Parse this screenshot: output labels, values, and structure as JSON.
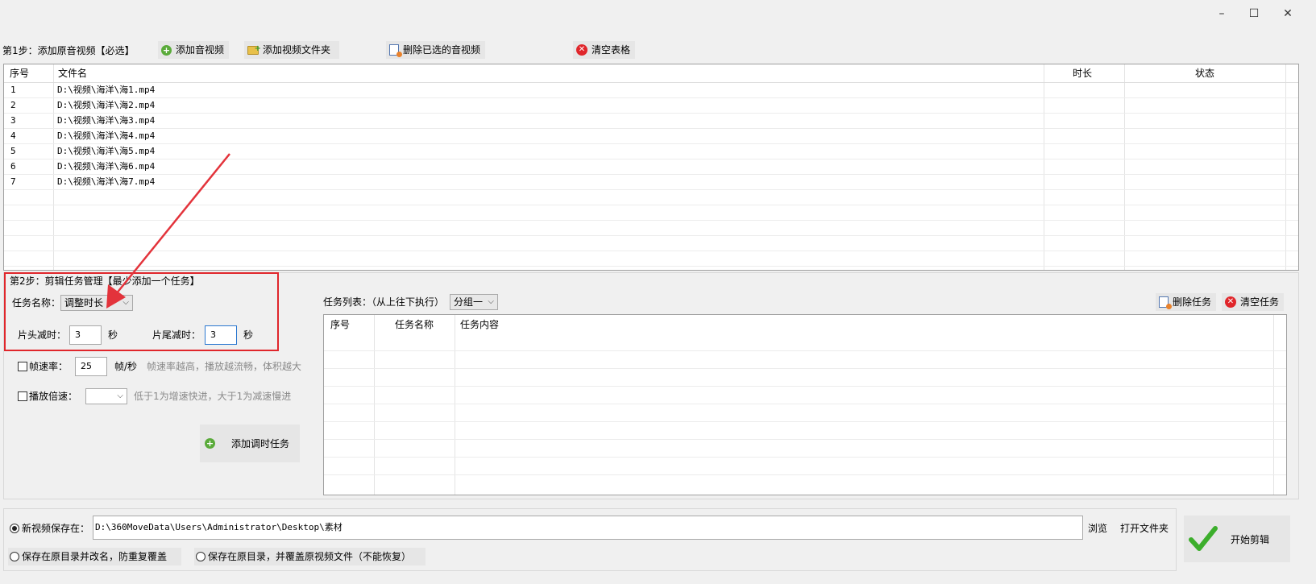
{
  "window": {
    "minimize_glyph": "–",
    "maximize_glyph": "☐",
    "close_glyph": "✕"
  },
  "step1": {
    "label": "第1步：添加原音视频【必选】",
    "add_av": "添加音视频",
    "add_folder": "添加视频文件夹",
    "delete_selected": "删除已选的音视频",
    "clear_table": "清空表格"
  },
  "file_table": {
    "columns": {
      "index": "序号",
      "filename": "文件名",
      "duration": "时长",
      "status": "状态"
    },
    "rows": [
      {
        "index": "1",
        "filename": "D:\\视频\\海洋\\海1.mp4"
      },
      {
        "index": "2",
        "filename": "D:\\视频\\海洋\\海2.mp4"
      },
      {
        "index": "3",
        "filename": "D:\\视频\\海洋\\海3.mp4"
      },
      {
        "index": "4",
        "filename": "D:\\视频\\海洋\\海4.mp4"
      },
      {
        "index": "5",
        "filename": "D:\\视频\\海洋\\海5.mp4"
      },
      {
        "index": "6",
        "filename": "D:\\视频\\海洋\\海6.mp4"
      },
      {
        "index": "7",
        "filename": "D:\\视频\\海洋\\海7.mp4"
      }
    ]
  },
  "step2": {
    "label": "第2步：剪辑任务管理【最少添加一个任务】",
    "task_name_label": "任务名称：",
    "task_name_value": "调整时长",
    "head_cut_label": "片头减时：",
    "head_cut_value": "3",
    "tail_cut_label": "片尾减时：",
    "tail_cut_value": "3",
    "sec_unit": "秒",
    "framerate_label": "帧速率：",
    "framerate_value": "25",
    "framerate_unit": "帧/秒",
    "framerate_hint": "帧速率越高，播放越流畅，体积越大",
    "speed_label": "播放倍速：",
    "speed_value": "",
    "speed_hint": "低于1为增速快进，大于1为减速慢进",
    "add_task_button": "添加调时任务"
  },
  "task_list": {
    "label": "任务列表：（从上往下执行）",
    "group_value": "分组一",
    "delete_task": "删除任务",
    "clear_tasks": "清空任务",
    "columns": {
      "index": "序号",
      "name": "任务名称",
      "content": "任务内容"
    }
  },
  "output": {
    "save_new_label": "新视频保存在：",
    "save_path": "D:\\360MoveData\\Users\\Administrator\\Desktop\\素材",
    "browse": "浏览",
    "open_folder": "打开文件夹",
    "option_rename": "保存在原目录并改名，防重复覆盖",
    "option_overwrite": "保存在原目录，并覆盖原视频文件（不能恢复）",
    "start_button": "开始剪辑"
  },
  "colors": {
    "highlight_box": "#e0262b",
    "arrow": "#e3333b",
    "start_check": "#3cae2c"
  }
}
